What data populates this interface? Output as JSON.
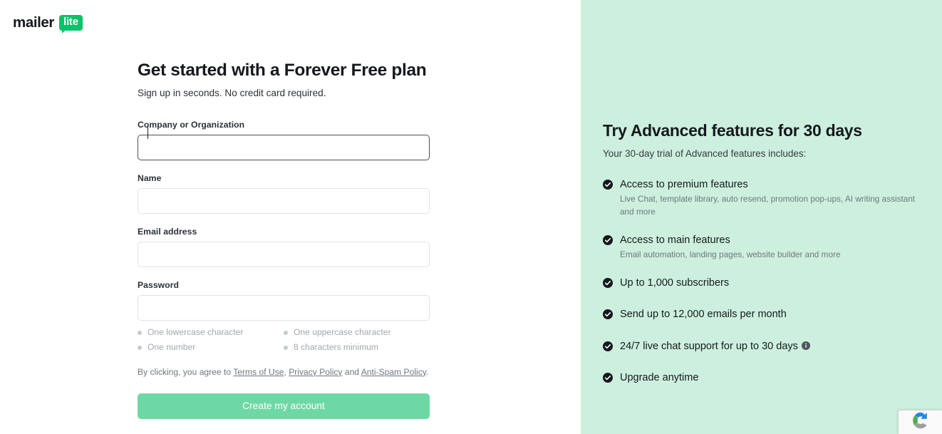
{
  "brand": {
    "logo_word": "mailer",
    "logo_badge": "lite",
    "badge_color": "#09c269"
  },
  "signup": {
    "title": "Get started with a Forever Free plan",
    "subtitle": "Sign up in seconds. No credit card required.",
    "fields": [
      {
        "label": "Company or Organization",
        "value": "",
        "placeholder": "",
        "focused": true
      },
      {
        "label": "Name",
        "value": "",
        "placeholder": "",
        "focused": false
      },
      {
        "label": "Email address",
        "value": "",
        "placeholder": "",
        "focused": false
      },
      {
        "label": "Password",
        "value": "",
        "placeholder": "",
        "focused": false
      }
    ],
    "password_rules": [
      "One lowercase character",
      "One uppercase character",
      "One number",
      "8 characters minimum"
    ],
    "legal": {
      "prefix": "By clicking, you agree to ",
      "link1": "Terms of Use",
      "sep1": ", ",
      "link2": "Privacy Policy",
      "sep2": " and ",
      "link3": "Anti-Spam Policy",
      "suffix": "."
    },
    "submit_label": "Create my account",
    "submit_color": "#6ed8a5"
  },
  "promo": {
    "background_color": "#cdf0de",
    "title": "Try Advanced features for 30 days",
    "subtitle": "Your 30-day trial of Advanced features includes:",
    "features": [
      {
        "title": "Access to premium features",
        "description": "Live Chat, template library, auto resend, promotion pop-ups, AI writing assistant and more",
        "has_info_icon": false
      },
      {
        "title": "Access to main features",
        "description": "Email automation, landing pages, website builder and more",
        "has_info_icon": false
      },
      {
        "title": "Up to 1,000 subscribers",
        "description": "",
        "has_info_icon": false
      },
      {
        "title": "Send up to 12,000 emails per month",
        "description": "",
        "has_info_icon": false
      },
      {
        "title": "24/7 live chat support for up to 30 days",
        "description": "",
        "has_info_icon": true
      },
      {
        "title": "Upgrade anytime",
        "description": "",
        "has_info_icon": false
      }
    ]
  },
  "recaptcha": {
    "icon_name": "recaptcha-logo"
  }
}
